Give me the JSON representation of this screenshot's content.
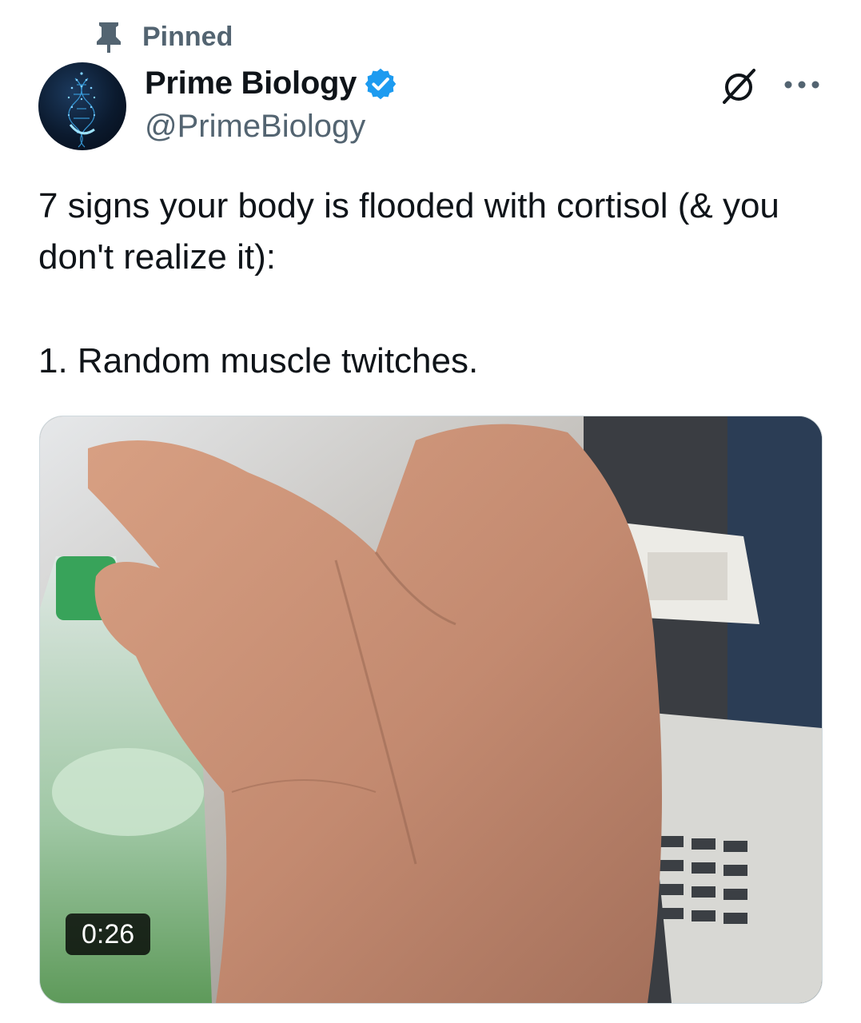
{
  "pinned": {
    "label": "Pinned",
    "icon": "pin-icon"
  },
  "account": {
    "display_name": "Prime Biology",
    "handle": "@PrimeBiology",
    "verified_icon": "verified-badge-icon",
    "verified_color": "#1d9bf0"
  },
  "actions": {
    "grok_icon": "grok-icon",
    "more_icon": "more-options-icon"
  },
  "tweet": {
    "line1": "7 signs your body is flooded with cortisol (& you don't realize it):",
    "line2": "1. Random muscle twitches."
  },
  "media": {
    "type": "video",
    "duration": "0:26"
  },
  "colors": {
    "text": "#0f1419",
    "secondary": "#536471",
    "border": "#cfd9de"
  }
}
